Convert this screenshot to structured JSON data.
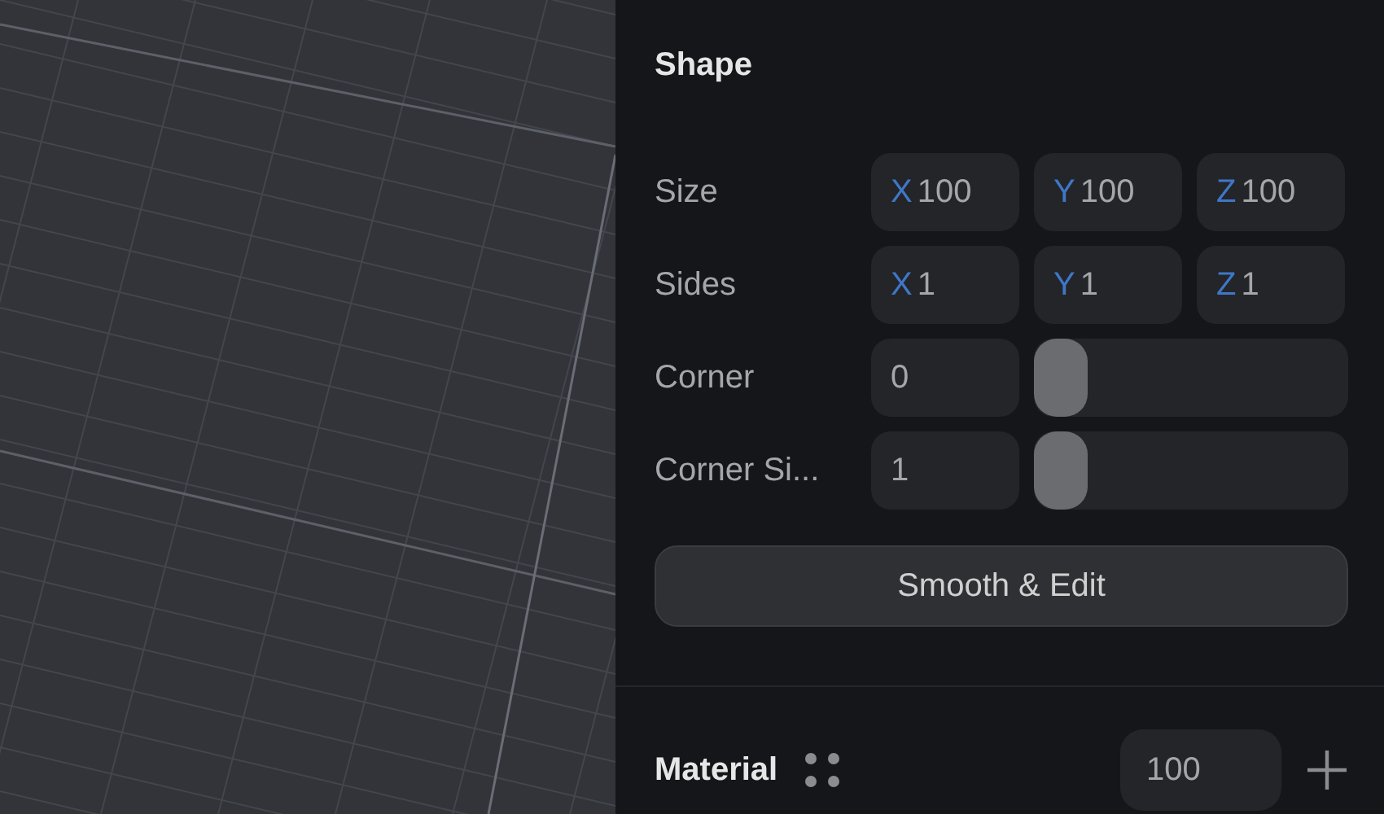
{
  "panel": {
    "title": "Shape",
    "rows": [
      {
        "kind": "xyz",
        "label": "Size",
        "fields": [
          {
            "axis": "X",
            "value": "100"
          },
          {
            "axis": "Y",
            "value": "100"
          },
          {
            "axis": "Z",
            "value": "100"
          }
        ]
      },
      {
        "kind": "xyz",
        "label": "Sides",
        "fields": [
          {
            "axis": "X",
            "value": "1"
          },
          {
            "axis": "Y",
            "value": "1"
          },
          {
            "axis": "Z",
            "value": "1"
          }
        ]
      },
      {
        "kind": "slider",
        "label": "Corner",
        "value": "0",
        "level": 0
      },
      {
        "kind": "slider",
        "label": "Corner Si...",
        "value": "1",
        "level": 0
      }
    ],
    "button": "Smooth & Edit"
  },
  "material": {
    "title": "Material",
    "value": "100"
  }
}
